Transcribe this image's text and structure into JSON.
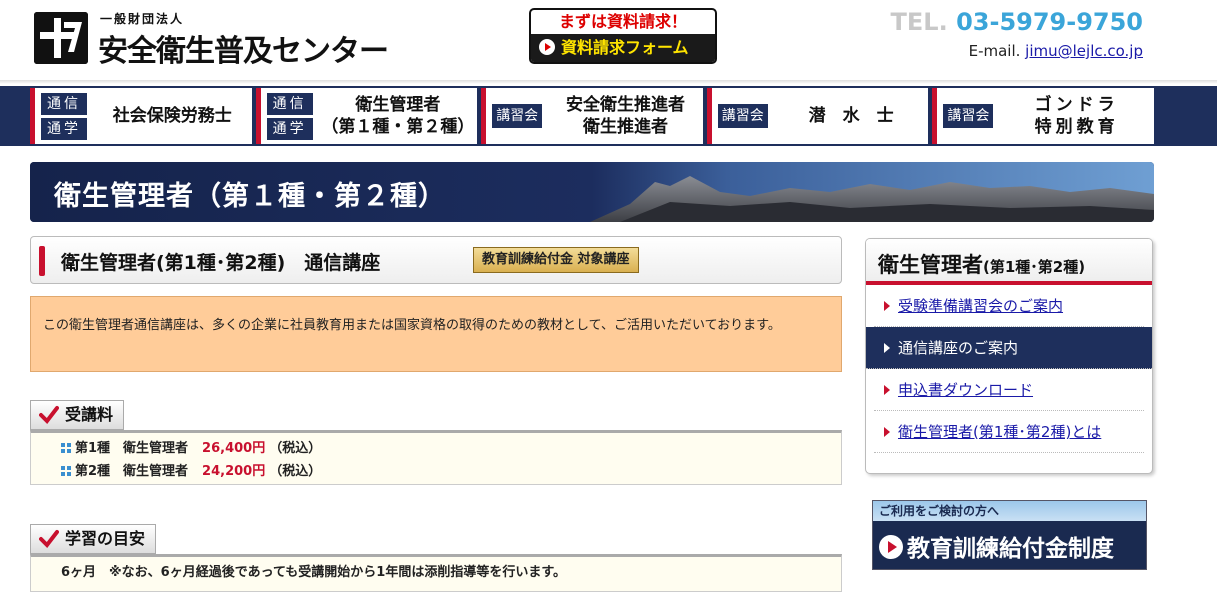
{
  "header": {
    "org_type": "一般財団法人",
    "org_name": "安全衛生普及センター",
    "cta_top": "まずは資料請求！",
    "cta_bottom": "資料請求フォーム",
    "tel_label": "TEL.",
    "tel_number": "03-5979-9750",
    "email_label": "E-mail.",
    "email": "jimu@lejlc.co.jp"
  },
  "nav": [
    {
      "tags": [
        "通信",
        "通学"
      ],
      "label": "社会保険労務士"
    },
    {
      "tags": [
        "通信",
        "通学"
      ],
      "label": "衛生管理者\n（第１種・第２種）"
    },
    {
      "tags": [
        "講習会"
      ],
      "label": "安全衛生推進者\n衛生推進者"
    },
    {
      "tags": [
        "講習会"
      ],
      "label": "潜　水　士"
    },
    {
      "tags": [
        "講習会"
      ],
      "label": "ゴンドラ\n特別教育"
    }
  ],
  "banner": {
    "title": "衛生管理者（第１種・第２種）"
  },
  "course": {
    "title": "衛生管理者(第1種･第2種)　通信講座",
    "badge": "教育訓練給付金 対象講座",
    "intro": "この衛生管理者通信講座は、多くの企業に社員教育用または国家資格の取得のための教材として、ご活用いただいております。"
  },
  "fees": {
    "heading": "受講料",
    "rows": [
      {
        "label": "第1種　衛生管理者",
        "price": "26,400円",
        "tax": "（税込）"
      },
      {
        "label": "第2種　衛生管理者",
        "price": "24,200円",
        "tax": "（税込）"
      }
    ]
  },
  "study": {
    "heading": "学習の目安",
    "text": "6ヶ月　※なお、6ヶ月経過後であっても受講開始から1年間は添削指導等を行います。"
  },
  "sidebar": {
    "title": "衛生管理者",
    "title_small": "(第1種･第2種)",
    "items": [
      {
        "label": "受験準備講習会のご案内",
        "active": false
      },
      {
        "label": "通信講座のご案内",
        "active": true
      },
      {
        "label": "申込書ダウンロード",
        "active": false
      },
      {
        "label": "衛生管理者(第1種･第2種)とは",
        "active": false
      }
    ]
  },
  "promo": {
    "top": "ご利用をご検討の方へ",
    "main": "教育訓練給付金制度"
  },
  "colors": {
    "navy": "#1e2f5c",
    "accent_red": "#c8102e",
    "tel_blue": "#3ba5d9",
    "intro_bg": "#ffcc99"
  }
}
